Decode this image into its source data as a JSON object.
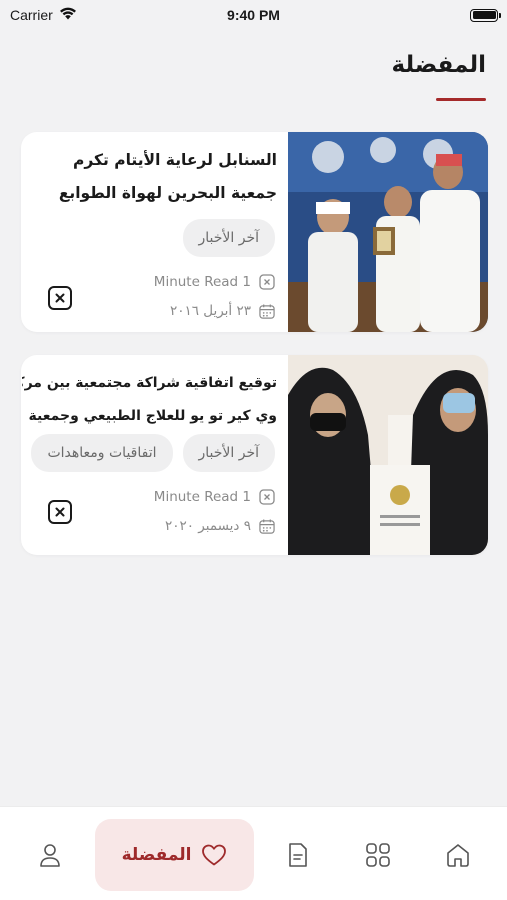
{
  "status_bar": {
    "carrier": "Carrier",
    "time": "9:40 PM"
  },
  "header": {
    "title": "المفضلة"
  },
  "favorites": [
    {
      "title_lines": [
        "السنابل لرعاية الأيتام تكرم",
        "جمعية البحرين لهواة الطوابع"
      ],
      "tags": [
        "آخر الأخبار"
      ],
      "read_time": "Minute Read 1",
      "date": "٢٣ أبريل ٢٠١٦"
    },
    {
      "title_lines": [
        "توقيع اتفاقية شراكة مجتمعية بين مركز",
        "وي كير تو يو للعلاج الطبيعي وجمعية"
      ],
      "tags": [
        "آخر الأخبار",
        "اتفاقيات ومعاهدات"
      ],
      "read_time": "Minute Read 1",
      "date": "٩ ديسمبر ٢٠٢٠"
    }
  ],
  "tab_bar": {
    "active_label": "المفضلة",
    "tabs": [
      "profile-icon",
      "heart-icon",
      "document-icon",
      "grid-icon",
      "home-icon"
    ]
  },
  "colors": {
    "accent": "#9e2a2b",
    "accent_bg": "#f8e7e7",
    "background": "#f2f2f3"
  }
}
